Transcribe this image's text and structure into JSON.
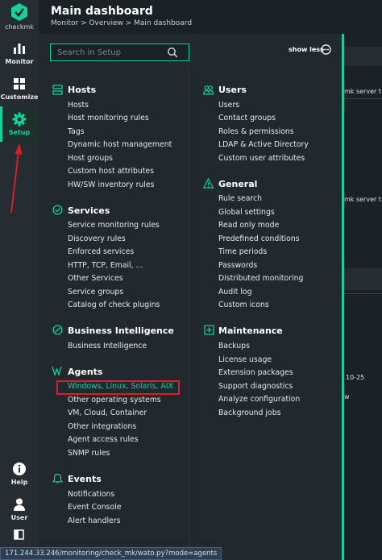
{
  "app": {
    "logo_text": "checkmk"
  },
  "sidebar": {
    "items": [
      {
        "label": "Monitor",
        "icon": "monitor-icon"
      },
      {
        "label": "Customize",
        "icon": "customize-icon"
      },
      {
        "label": "Setup",
        "icon": "gear-icon",
        "active": true
      },
      {
        "label": "Help",
        "icon": "help-icon"
      },
      {
        "label": "User",
        "icon": "user-icon"
      }
    ]
  },
  "header": {
    "title": "Main dashboard",
    "breadcrumb": "Monitor > Overview > Main dashboard"
  },
  "search": {
    "placeholder": "Search in Setup"
  },
  "menu": {
    "show_less_label": "show less",
    "topics": [
      {
        "title": "Hosts",
        "icon": "hosts-icon",
        "items": [
          "Hosts",
          "Host monitoring rules",
          "Tags",
          "Dynamic host management",
          "Host groups",
          "Custom host attributes",
          "HW/SW inventory rules"
        ]
      },
      {
        "title": "Services",
        "icon": "services-icon",
        "items": [
          "Service monitoring rules",
          "Discovery rules",
          "Enforced services",
          "HTTP, TCP, Email, ...",
          "Other Services",
          "Service groups",
          "Catalog of check plugins"
        ]
      },
      {
        "title": "Business Intelligence",
        "icon": "bi-icon",
        "items": [
          "Business Intelligence"
        ]
      },
      {
        "title": "Agents",
        "icon": "agents-icon",
        "items": [
          "Windows, Linux, Solaris, AIX",
          "Other operating systems",
          "VM, Cloud, Container",
          "Other integrations",
          "Agent access rules",
          "SNMP rules"
        ]
      },
      {
        "title": "Events",
        "icon": "events-icon",
        "items": [
          "Notifications",
          "Event Console",
          "Alert handlers"
        ]
      },
      {
        "title": "Users",
        "icon": "users-icon",
        "items": [
          "Users",
          "Contact groups",
          "Roles & permissions",
          "LDAP & Active Directory",
          "Custom user attributes"
        ]
      },
      {
        "title": "General",
        "icon": "general-icon",
        "items": [
          "Rule search",
          "Global settings",
          "Read only mode",
          "Predefined conditions",
          "Time periods",
          "Passwords",
          "Distributed monitoring",
          "Audit log",
          "Custom icons"
        ]
      },
      {
        "title": "Maintenance",
        "icon": "maintenance-icon",
        "items": [
          "Backups",
          "License usage",
          "Extension packages",
          "Support diagnostics",
          "Analyze configuration",
          "Background jobs"
        ]
      }
    ]
  },
  "background": {
    "texts": [
      "mk server t",
      "mk server t",
      "10-25",
      "w"
    ]
  },
  "statusbar": {
    "url": "171.244.33.246/monitoring/check_mk/wato.py?mode=agents"
  },
  "colors": {
    "accent": "#15d1a0",
    "highlight_box": "#d91e2c",
    "annotation_arrow": "#d91e2c"
  }
}
